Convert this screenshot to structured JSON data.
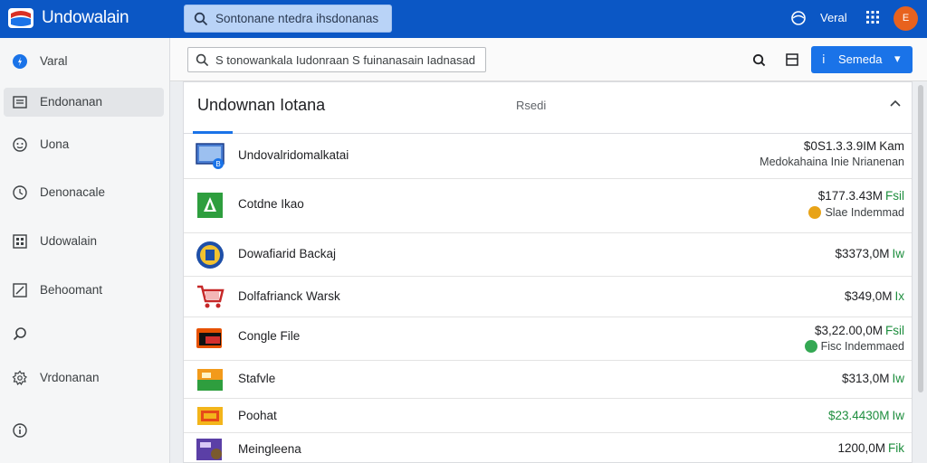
{
  "app": {
    "title": "Undowalain",
    "search_placeholder": "Sontonane ntedra ihsdonanas",
    "header_text": "Veral",
    "avatar_initial": "E"
  },
  "sidebar": {
    "items": [
      {
        "label": "Varal",
        "icon": "circle-dot-icon"
      },
      {
        "label": "Endonanan",
        "icon": "list-icon"
      },
      {
        "label": "Uona",
        "icon": "face-icon"
      },
      {
        "label": "Denonacale",
        "icon": "clock-icon"
      },
      {
        "label": "Udowalain",
        "icon": "grid-icon"
      },
      {
        "label": "Behoomant",
        "icon": "edit-icon"
      },
      {
        "label": "",
        "icon": "search-leaf-icon"
      },
      {
        "label": "Vrdonanan",
        "icon": "gear-icon"
      },
      {
        "label": "",
        "icon": "info-icon"
      }
    ]
  },
  "toolbar": {
    "search_value": "S tonowankala Iudonraan S fuinanasain Iadnasad",
    "primary_button": "Semeda"
  },
  "panel": {
    "title": "Undownan Iotana",
    "subtitle": "Rsedi",
    "rows": [
      {
        "name": "Undovalridomalkatai",
        "amount": "$0S1.3.3.9IM",
        "tag": "Kam",
        "note": "Medokahaina Inie Nrianenan",
        "note_badge": "",
        "thumb": "monitor-icon"
      },
      {
        "name": "Cotdne Ikao",
        "amount": "$177.3.43M",
        "tag": "Fsil",
        "note": "Slae Indemmad",
        "note_badge": "#e8a317",
        "thumb": "green-leaf-icon"
      },
      {
        "name": "Dowafiarid Backaj",
        "amount": "$3373,0M",
        "tag": "Iw",
        "note": "",
        "note_badge": "",
        "thumb": "coin-icon"
      },
      {
        "name": "Dolfafrianck Warsk",
        "amount": "$349,0M",
        "tag": "Ix",
        "note": "",
        "note_badge": "",
        "thumb": "cart-icon"
      },
      {
        "name": "Congle File",
        "amount": "$3,22.00,0M",
        "tag": "Fsil",
        "note": "Fisc Indemmaed",
        "note_badge": "#34a853",
        "thumb": "folder-icon"
      },
      {
        "name": "Stafvle",
        "amount": "$313,0M",
        "tag": "Iw",
        "note": "",
        "note_badge": "",
        "thumb": "box-icon"
      },
      {
        "name": "Poohat",
        "amount": "$23.4430M",
        "tag": "Iw",
        "note": "",
        "note_badge": "",
        "thumb": "package-icon"
      },
      {
        "name": "Meingleena",
        "amount": "1200,0M",
        "tag": "Fik",
        "note": "",
        "note_badge": "",
        "thumb": "bag-icon"
      }
    ]
  }
}
